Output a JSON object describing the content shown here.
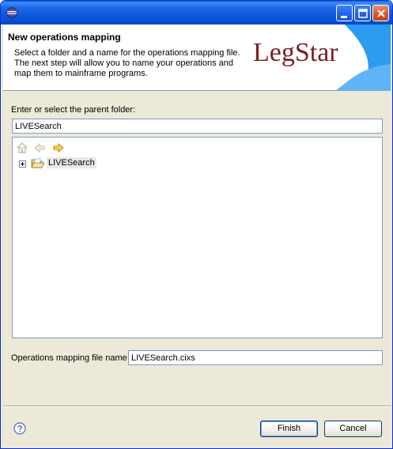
{
  "window": {
    "title": ""
  },
  "header": {
    "title": "New operations mapping",
    "description_lines": [
      "Select a folder and a name for the operations mapping file.",
      "The next step will allow you to name your operations and",
      "map them to mainframe programs."
    ],
    "logo_text": "LegStar"
  },
  "folder": {
    "label": "Enter or select the parent folder:",
    "value": "LIVESearch"
  },
  "tree": {
    "nav_icons": [
      "home-icon",
      "back-arrow-icon",
      "forward-arrow-icon"
    ],
    "items": [
      {
        "label": "LIVESearch",
        "icon": "open-folder-icon",
        "expanded": false
      }
    ]
  },
  "file_name": {
    "label": "Operations mapping file name",
    "value": "LIVESearch.cixs"
  },
  "buttons": {
    "finish": "Finish",
    "cancel": "Cancel"
  },
  "colors": {
    "titlebar": "#0854d9",
    "dialog_bg": "#ece9d8",
    "logo_text": "#7b1f1f",
    "logo_shape": "#2d9bf0"
  }
}
